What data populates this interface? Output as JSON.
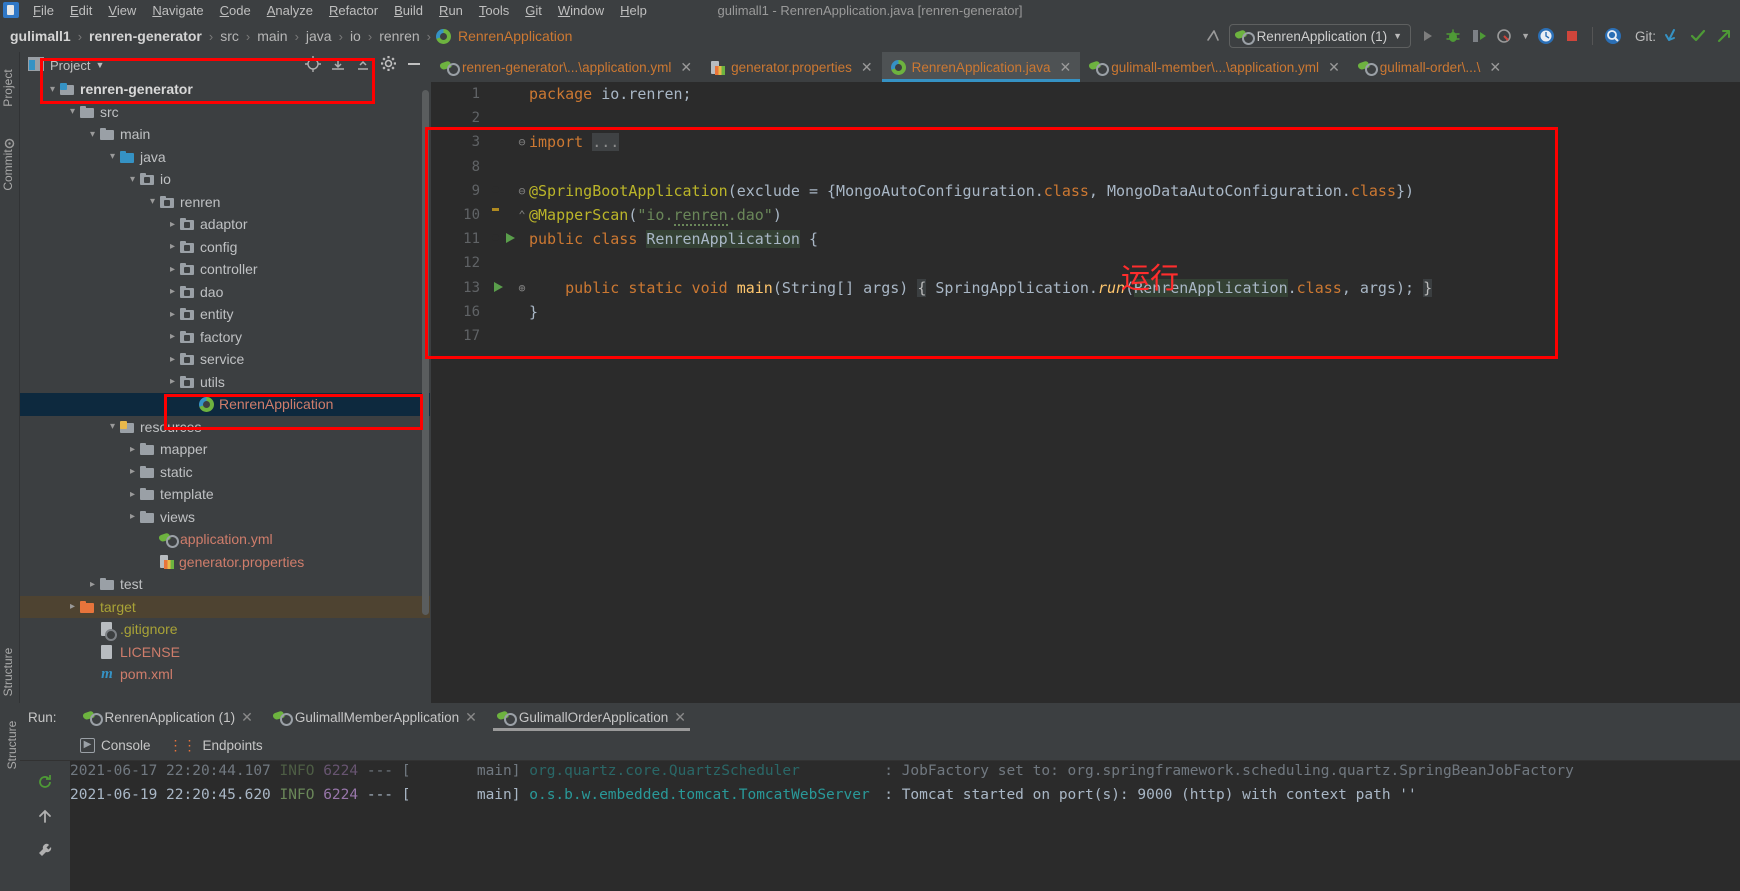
{
  "window": {
    "title": "gulimall1 - RenrenApplication.java [renren-generator]",
    "app_icon": "intellij-idea-icon"
  },
  "menubar": {
    "items": [
      "File",
      "Edit",
      "View",
      "Navigate",
      "Code",
      "Analyze",
      "Refactor",
      "Build",
      "Run",
      "Tools",
      "Git",
      "Window",
      "Help"
    ]
  },
  "breadcrumb": {
    "items": [
      "gulimall1",
      "renren-generator",
      "src",
      "main",
      "java",
      "io",
      "renren",
      "RenrenApplication"
    ],
    "separator": "›",
    "class_icon": "spring-boot-class-icon"
  },
  "toolbar": {
    "back_icon": "arrow-up-left-icon",
    "run_config_name": "RenrenApplication (1)",
    "run_config_icon": "spring-boot-icon",
    "dropdown_icon": "chevron-down-icon",
    "run_icon": "run-play-icon",
    "debug_icon": "debug-bug-icon",
    "run_coverage_icon": "run-with-coverage-icon",
    "profiler_icon": "profiler-icon",
    "profiler_dropdown_icon": "chevron-down-icon",
    "update_icon": "update-running-app-icon",
    "stop_icon": "stop-square-icon",
    "search_everywhere_icon": "search-everywhere-icon",
    "git_label": "Git:",
    "git_update_icon": "git-update-project-icon",
    "git_commit_icon": "git-commit-checkmark-icon",
    "git_push_icon": "git-push-arrow-icon"
  },
  "left_tool_strip": {
    "tabs": [
      "Project",
      "Commit",
      "Structure"
    ],
    "bottom_icon": "favorites-icon"
  },
  "project_panel": {
    "title": "Project",
    "title_dropdown_icon": "chevron-down-icon",
    "window_icon": "project-window-icon",
    "icons": [
      "locate-target-icon",
      "expand-all-icon",
      "collapse-all-icon",
      "gear-icon",
      "hide-minus-icon"
    ],
    "tree": [
      {
        "label": "renren-generator",
        "depth": 1,
        "twig": "v",
        "icon": "module-folder-icon",
        "style": "bold",
        "state": "normal"
      },
      {
        "label": "src",
        "depth": 2,
        "twig": "v",
        "icon": "folder-icon",
        "style": "white",
        "state": "normal"
      },
      {
        "label": "main",
        "depth": 3,
        "twig": "v",
        "icon": "folder-icon",
        "style": "white",
        "state": "normal"
      },
      {
        "label": "java",
        "depth": 4,
        "twig": "v",
        "icon": "source-folder-icon",
        "style": "white",
        "state": "normal"
      },
      {
        "label": "io",
        "depth": 5,
        "twig": "v",
        "icon": "package-icon",
        "style": "white",
        "state": "normal"
      },
      {
        "label": "renren",
        "depth": 6,
        "twig": "v",
        "icon": "package-icon",
        "style": "white",
        "state": "normal"
      },
      {
        "label": "adaptor",
        "depth": 7,
        "twig": ">",
        "icon": "package-icon",
        "style": "white",
        "state": "normal"
      },
      {
        "label": "config",
        "depth": 7,
        "twig": ">",
        "icon": "package-icon",
        "style": "white",
        "state": "normal"
      },
      {
        "label": "controller",
        "depth": 7,
        "twig": ">",
        "icon": "package-icon",
        "style": "white",
        "state": "normal"
      },
      {
        "label": "dao",
        "depth": 7,
        "twig": ">",
        "icon": "package-icon",
        "style": "white",
        "state": "normal"
      },
      {
        "label": "entity",
        "depth": 7,
        "twig": ">",
        "icon": "package-icon",
        "style": "white",
        "state": "normal"
      },
      {
        "label": "factory",
        "depth": 7,
        "twig": ">",
        "icon": "package-icon",
        "style": "white",
        "state": "normal"
      },
      {
        "label": "service",
        "depth": 7,
        "twig": ">",
        "icon": "package-icon",
        "style": "white",
        "state": "normal"
      },
      {
        "label": "utils",
        "depth": 7,
        "twig": ">",
        "icon": "package-icon",
        "style": "white",
        "state": "normal"
      },
      {
        "label": "RenrenApplication",
        "depth": 8,
        "twig": "",
        "icon": "spring-boot-class-icon",
        "style": "red",
        "state": "selected"
      },
      {
        "label": "resources",
        "depth": 4,
        "twig": "v",
        "icon": "resources-folder-icon",
        "style": "white",
        "state": "normal"
      },
      {
        "label": "mapper",
        "depth": 5,
        "twig": ">",
        "icon": "folder-icon",
        "style": "white",
        "state": "normal"
      },
      {
        "label": "static",
        "depth": 5,
        "twig": ">",
        "icon": "folder-icon",
        "style": "white",
        "state": "normal"
      },
      {
        "label": "template",
        "depth": 5,
        "twig": ">",
        "icon": "folder-icon",
        "style": "white",
        "state": "normal"
      },
      {
        "label": "views",
        "depth": 5,
        "twig": ">",
        "icon": "folder-icon",
        "style": "white",
        "state": "normal"
      },
      {
        "label": "application.yml",
        "depth": 6,
        "twig": "",
        "icon": "spring-yaml-icon",
        "style": "red",
        "state": "normal"
      },
      {
        "label": "generator.properties",
        "depth": 6,
        "twig": "",
        "icon": "properties-file-icon",
        "style": "red",
        "state": "normal"
      },
      {
        "label": "test",
        "depth": 3,
        "twig": ">",
        "icon": "folder-icon",
        "style": "white",
        "state": "normal"
      },
      {
        "label": "target",
        "depth": 2,
        "twig": ">",
        "icon": "excluded-folder-icon",
        "style": "yellow",
        "state": "highlighted"
      },
      {
        "label": ".gitignore",
        "depth": 3,
        "twig": "",
        "icon": "gitignore-file-icon",
        "style": "yellow",
        "state": "normal"
      },
      {
        "label": "LICENSE",
        "depth": 3,
        "twig": "",
        "icon": "text-file-icon",
        "style": "red",
        "state": "normal"
      },
      {
        "label": "pom.xml",
        "depth": 3,
        "twig": "",
        "icon": "maven-pom-icon",
        "style": "red",
        "state": "normal"
      }
    ]
  },
  "editor": {
    "tabs": [
      {
        "label": "renren-generator\\...\\application.yml",
        "icon": "spring-yaml-icon",
        "active": false,
        "close_icon": "close-icon"
      },
      {
        "label": "generator.properties",
        "icon": "properties-file-icon",
        "active": false,
        "close_icon": "close-icon"
      },
      {
        "label": "RenrenApplication.java",
        "icon": "spring-boot-class-icon",
        "active": true,
        "close_icon": "close-icon"
      },
      {
        "label": "gulimall-member\\...\\application.yml",
        "icon": "spring-yaml-icon",
        "active": false,
        "close_icon": "close-icon"
      },
      {
        "label": "gulimall-order\\...\\",
        "icon": "spring-yaml-icon",
        "active": false,
        "close_icon": "close-icon"
      }
    ],
    "lines": [
      {
        "num": "1",
        "fold": "",
        "gutter_icon": "",
        "text": "package io.renren;"
      },
      {
        "num": "2",
        "fold": "",
        "gutter_icon": "",
        "text": ""
      },
      {
        "num": "3",
        "fold": "-",
        "gutter_icon": "",
        "text": "import ..."
      },
      {
        "num": "8",
        "fold": "",
        "gutter_icon": "",
        "text": ""
      },
      {
        "num": "9",
        "fold": "-",
        "gutter_icon": "spring-boot-icon",
        "text": "@SpringBootApplication(exclude = {MongoAutoConfiguration.class, MongoDataAutoConfiguration.class})"
      },
      {
        "num": "10",
        "fold": "^",
        "gutter_icon": "lightbulb-icon",
        "text": "@MapperScan(\"io.renren.dao\")"
      },
      {
        "num": "11",
        "fold": "",
        "gutter_icon": "run-class-icon",
        "text": "public class RenrenApplication {"
      },
      {
        "num": "12",
        "fold": "",
        "gutter_icon": "",
        "text": ""
      },
      {
        "num": "13",
        "fold": "+",
        "gutter_icon": "run-method-icon",
        "text": "    public static void main(String[] args) { SpringApplication.run(RenrenApplication.class, args); }"
      },
      {
        "num": "16",
        "fold": "",
        "gutter_icon": "",
        "text": "}"
      },
      {
        "num": "17",
        "fold": "",
        "gutter_icon": "",
        "text": ""
      }
    ],
    "annotation_text": "运行"
  },
  "run_window": {
    "label": "Run:",
    "tabs": [
      {
        "label": "RenrenApplication (1)",
        "icon": "spring-boot-icon",
        "active": false,
        "close_icon": "close-icon"
      },
      {
        "label": "GulimallMemberApplication",
        "icon": "spring-boot-icon",
        "active": false,
        "close_icon": "close-icon"
      },
      {
        "label": "GulimallOrderApplication",
        "icon": "spring-boot-running-icon",
        "active": true,
        "close_icon": "close-icon"
      }
    ],
    "subtabs": [
      {
        "label": "Console",
        "icon": "console-icon"
      },
      {
        "label": "Endpoints",
        "icon": "endpoints-icon"
      }
    ],
    "side_icons": [
      "rerun-icon",
      "scroll-up-icon",
      "wrench-icon"
    ],
    "console_lines": [
      {
        "timestamp": "2021-06-17 22:20:44.107",
        "level": "INFO",
        "pid": "6224",
        "dashes": "--- [",
        "thread": "main]",
        "logger": "org.quartz.core.QuartzScheduler",
        "message": ": JobFactory set to: org.springframework.scheduling.quartz.SpringBeanJobFactory"
      },
      {
        "timestamp": "2021-06-19 22:20:45.620",
        "level": "INFO",
        "pid": "6224",
        "dashes": "--- [",
        "thread": "main]",
        "logger": "o.s.b.w.embedded.tomcat.TomcatWebServer",
        "message": ": Tomcat started on port(s): 9000 (http) with context path ''"
      }
    ]
  },
  "colors": {
    "accent_blue": "#3592c4",
    "annotation_red": "#ff0000",
    "spring_green": "#6db33f",
    "selection_blue": "#0d293e",
    "editor_bg": "#2b2b2b",
    "panel_bg": "#3c3f41"
  }
}
